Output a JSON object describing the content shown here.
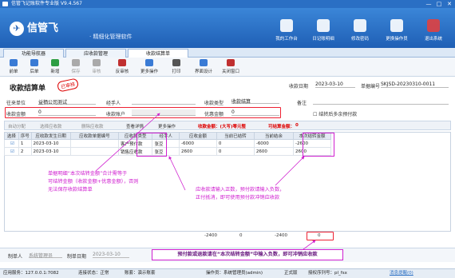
{
  "window": {
    "title": "信管飞记账软件专业版 V9.4.567",
    "min": "—",
    "max": "□",
    "close": "✕"
  },
  "banner": {
    "logo": "信管飞",
    "slogan": "· 精细化管理软件",
    "nav": [
      {
        "label": "我的工作台",
        "icon": "desk-icon"
      },
      {
        "label": "日记账明细",
        "icon": "ledger-icon"
      },
      {
        "label": "修改密码",
        "icon": "key-icon"
      },
      {
        "label": "更换操作员",
        "icon": "user-icon"
      },
      {
        "label": "退出系统",
        "icon": "exit-icon"
      }
    ]
  },
  "tabs": [
    {
      "label": "功能导航器"
    },
    {
      "label": "应收款管理"
    },
    {
      "label": "收款结算单",
      "active": true
    }
  ],
  "toolbar": [
    {
      "label": "前单",
      "icon": "prev-icon",
      "color": "#3a7bd5"
    },
    {
      "label": "后单",
      "icon": "next-icon",
      "color": "#3a7bd5"
    },
    {
      "label": "新增",
      "icon": "add-icon",
      "color": "#2e9e44"
    },
    {
      "label": "保存",
      "icon": "save-icon",
      "color": "#aaaaaa",
      "disabled": true
    },
    {
      "label": "审核",
      "icon": "audit-icon",
      "color": "#aaaaaa",
      "disabled": true
    },
    {
      "label": "反审核",
      "icon": "unaudit-icon",
      "color": "#c03030"
    },
    {
      "label": "更多操作",
      "icon": "more-icon",
      "color": "#3a7bd5"
    },
    {
      "label": "打印",
      "icon": "print-icon",
      "color": "#555555"
    },
    {
      "label": "界面设计",
      "icon": "design-icon",
      "color": "#3a7bd5"
    },
    {
      "label": "关闭窗口",
      "icon": "close-window-icon",
      "color": "#c03030"
    }
  ],
  "form": {
    "title": "收款结算单",
    "stamp": "已审核",
    "date_label": "收款日期",
    "date_value": "2023-03-10",
    "no_label": "单据编号",
    "no_value": "SKJSD-20230310-0011",
    "unit_label": "往来单位",
    "unit_value": "益栖公司测试",
    "handler_label": "经手人",
    "type_label": "收款类型",
    "type_value": "收款结算",
    "note_label": "备注",
    "amount_label": "收款金额",
    "amount_value": "0",
    "account_label": "收款账户",
    "discount_label": "优惠金额",
    "discount_value": "0",
    "advance_label": "结转后多余预付款"
  },
  "gridbar": {
    "auto_assign": "自动分配",
    "select_receivable": "选择应收款",
    "delete_receivable": "删除应收款",
    "detail": "查看详情",
    "more": "更多操作",
    "summary": "收款金额：(大写)零元整",
    "settle_label": "可结算金额：",
    "settle_value": "0"
  },
  "table": {
    "headers": [
      "选择",
      "序号",
      "应收款发生日期",
      "应收款单据编号",
      "应收款类型",
      "经手人",
      "应收金额",
      "当前已结转",
      "当前结余",
      "本次结转金额"
    ],
    "rows": [
      {
        "check": "☑",
        "no": "1",
        "date": "2023-03-10",
        "docno": "",
        "type": "客户预付款",
        "handler": "张豆",
        "amount": "-6000",
        "done": "0",
        "remain": "-6000",
        "this": "-2600"
      },
      {
        "check": "☑",
        "no": "2",
        "date": "2023-03-10",
        "docno": "",
        "type": "销售应收款",
        "handler": "张豆",
        "amount": "2600",
        "done": "0",
        "remain": "2600",
        "this": "2600"
      }
    ],
    "footer": {
      "amount": "-2400",
      "done": "0",
      "remain": "-2400",
      "this": "0"
    }
  },
  "annotations": {
    "left": "单据明细“本次结转金额”合计需等于\n可结转金额（收款金额+优惠金额），否则\n无法保存收款结算单",
    "right": "应收款请输入正数，预付款请输入负数，\n正付抵消，即可使用预付款冲销应收款",
    "bottom": "预付款或退款请在“本次结转金额”中输入负数，即可冲销应收款"
  },
  "bottomrow": {
    "maker_label": "制单人",
    "maker_value": "系统管理员",
    "makedate_label": "制单日期",
    "makedate_value": "2023-03-10"
  },
  "status": {
    "server": "应用服务：127.0.0.1:7082",
    "conn": "连接状态：正常",
    "account": "账套：演示账套",
    "operator": "操作员：系统管理员(admin)",
    "edition": "正式版",
    "auth": "授权序列号：pl_fsx",
    "msg": "消息提醒(0)"
  }
}
